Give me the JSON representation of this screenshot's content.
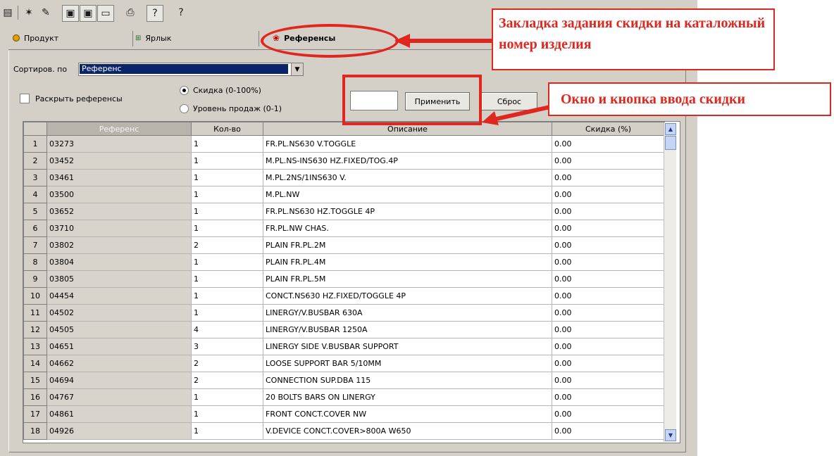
{
  "tabs": [
    {
      "label": "Продукт",
      "icon": "bullet-icon"
    },
    {
      "label": "Ярлык",
      "icon": "label-icon"
    },
    {
      "label": "Референсы",
      "icon": "references-icon"
    }
  ],
  "sort": {
    "label": "Сортиров. по",
    "value": "Референс"
  },
  "expand_refs_label": "Раскрыть референсы",
  "radio_discount_label": "Скидка (0-100%)",
  "radio_sales_label": "Уровень продаж (0-1)",
  "discount_input_value": "",
  "apply_button": "Применить",
  "reset_button": "Сброс",
  "annotations": {
    "tab_note": "Закладка задания скидки на каталожный номер изделия",
    "input_note": "Окно и кнопка ввода скидки"
  },
  "table": {
    "columns": [
      "Референс",
      "Кол-во",
      "Описание",
      "Скидка (%)"
    ],
    "rows": [
      {
        "n": "1",
        "ref": "03273",
        "qty": "1",
        "desc": "FR.PL.NS630 V.TOGGLE",
        "disc": "0.00"
      },
      {
        "n": "2",
        "ref": "03452",
        "qty": "1",
        "desc": "M.PL.NS-INS630 HZ.FIXED/TOG.4P",
        "disc": "0.00"
      },
      {
        "n": "3",
        "ref": "03461",
        "qty": "1",
        "desc": "M.PL.2NS/1INS630 V.",
        "disc": "0.00"
      },
      {
        "n": "4",
        "ref": "03500",
        "qty": "1",
        "desc": "M.PL.NW",
        "disc": "0.00"
      },
      {
        "n": "5",
        "ref": "03652",
        "qty": "1",
        "desc": "FR.PL.NS630 HZ.TOGGLE 4P",
        "disc": "0.00"
      },
      {
        "n": "6",
        "ref": "03710",
        "qty": "1",
        "desc": "FR.PL.NW CHAS.",
        "disc": "0.00"
      },
      {
        "n": "7",
        "ref": "03802",
        "qty": "2",
        "desc": "PLAIN FR.PL.2M",
        "disc": "0.00"
      },
      {
        "n": "8",
        "ref": "03804",
        "qty": "1",
        "desc": "PLAIN FR.PL.4M",
        "disc": "0.00"
      },
      {
        "n": "9",
        "ref": "03805",
        "qty": "1",
        "desc": "PLAIN FR.PL.5M",
        "disc": "0.00"
      },
      {
        "n": "10",
        "ref": "04454",
        "qty": "1",
        "desc": "CONCT.NS630 HZ.FIXED/TOGGLE 4P",
        "disc": "0.00"
      },
      {
        "n": "11",
        "ref": "04502",
        "qty": "1",
        "desc": "LINERGY/V.BUSBAR 630A",
        "disc": "0.00"
      },
      {
        "n": "12",
        "ref": "04505",
        "qty": "4",
        "desc": "LINERGY/V.BUSBAR 1250A",
        "disc": "0.00"
      },
      {
        "n": "13",
        "ref": "04651",
        "qty": "3",
        "desc": "LINERGY SIDE V.BUSBAR SUPPORT",
        "disc": "0.00"
      },
      {
        "n": "14",
        "ref": "04662",
        "qty": "2",
        "desc": "LOOSE SUPPORT BAR 5/10MM",
        "disc": "0.00"
      },
      {
        "n": "15",
        "ref": "04694",
        "qty": "2",
        "desc": "CONNECTION SUP.DBA 115",
        "disc": "0.00"
      },
      {
        "n": "16",
        "ref": "04767",
        "qty": "1",
        "desc": "20 BOLTS BARS ON LINERGY",
        "disc": "0.00"
      },
      {
        "n": "17",
        "ref": "04861",
        "qty": "1",
        "desc": "FRONT CONCT.COVER NW",
        "disc": "0.00"
      },
      {
        "n": "18",
        "ref": "04926",
        "qty": "1",
        "desc": "V.DEVICE CONCT.COVER>800A W650",
        "disc": "0.00"
      }
    ]
  },
  "colors": {
    "annotation_red": "#e0271f",
    "selection_blue": "#0a246a",
    "window_gray": "#d4d0c8"
  }
}
